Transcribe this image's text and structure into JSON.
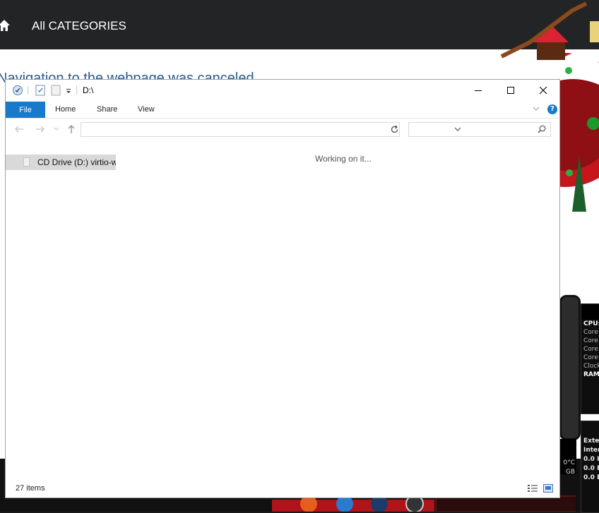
{
  "background_page": {
    "nav_label": "All CATEGORIES",
    "message": "Navigation to the webpage was canceled"
  },
  "gadgets": {
    "cpu_lines": [
      "CPU:",
      "Core",
      "Core",
      "Core",
      "Core",
      "Clock",
      "RAM"
    ],
    "ext_lines": [
      "Exte",
      "Inter",
      "0.0 I",
      "0.0 E",
      "0.0 E"
    ],
    "temp_lines": [
      "0°C",
      "GB"
    ]
  },
  "explorer": {
    "title": "D:\\",
    "tabs": {
      "file": "File",
      "home": "Home",
      "share": "Share",
      "view": "View"
    },
    "address_value": "",
    "search_placeholder": "",
    "nav_items": [
      {
        "label": "CD Drive (D:) virtio-win"
      }
    ],
    "content_message": "Working on it...",
    "status": "27 items",
    "accent": "#1979ca"
  }
}
